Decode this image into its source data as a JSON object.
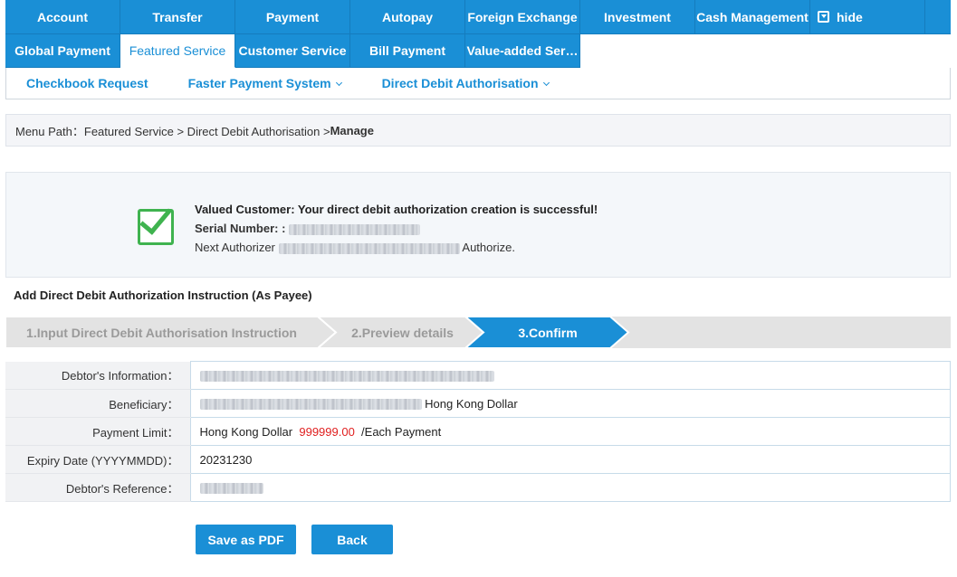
{
  "nav": {
    "row1": [
      "Account",
      "Transfer",
      "Payment",
      "Autopay",
      "Foreign Exchange",
      "Investment",
      "Cash Management"
    ],
    "hide_label": "hide",
    "row2": [
      "Global Payment",
      "Featured Service",
      "Customer Service",
      "Bill Payment",
      "Value-added Ser…"
    ],
    "active": "Featured Service"
  },
  "subnav": {
    "items": [
      "Checkbook Request",
      "Faster Payment System",
      "Direct Debit Authorisation"
    ]
  },
  "breadcrumb": {
    "prefix": "Menu Path：Featured Service > Direct Debit Authorisation > ",
    "current": "Manage"
  },
  "success": {
    "title": "Valued Customer: Your direct debit authorization creation is successful!",
    "serial_label": "Serial Number:",
    "serial_sep": ":",
    "next_label": "Next Authorizer",
    "authorize_label": "Authorize."
  },
  "section_title": "Add Direct Debit Authorization Instruction (As Payee)",
  "steps": [
    {
      "label": "1.Input Direct Debit Authorisation Instruction",
      "state": "done"
    },
    {
      "label": "2.Preview details",
      "state": "done"
    },
    {
      "label": "3.Confirm",
      "state": "current"
    }
  ],
  "details": {
    "debtor_info_label": "Debtor's Information：",
    "beneficiary_label": "Beneficiary：",
    "beneficiary_currency": "Hong Kong Dollar",
    "payment_limit_label": "Payment Limit：",
    "payment_limit_currency": "Hong Kong Dollar",
    "payment_limit_amount": "999999.00",
    "payment_limit_suffix": "/Each Payment",
    "expiry_label": "Expiry Date (YYYYMMDD)：",
    "expiry_value": "20231230",
    "debtor_ref_label": "Debtor's Reference："
  },
  "buttons": {
    "save_pdf": "Save as PDF",
    "back": "Back"
  },
  "colors": {
    "primary": "#1a8fd6",
    "success": "#3fb34f",
    "amount": "#e02020"
  }
}
